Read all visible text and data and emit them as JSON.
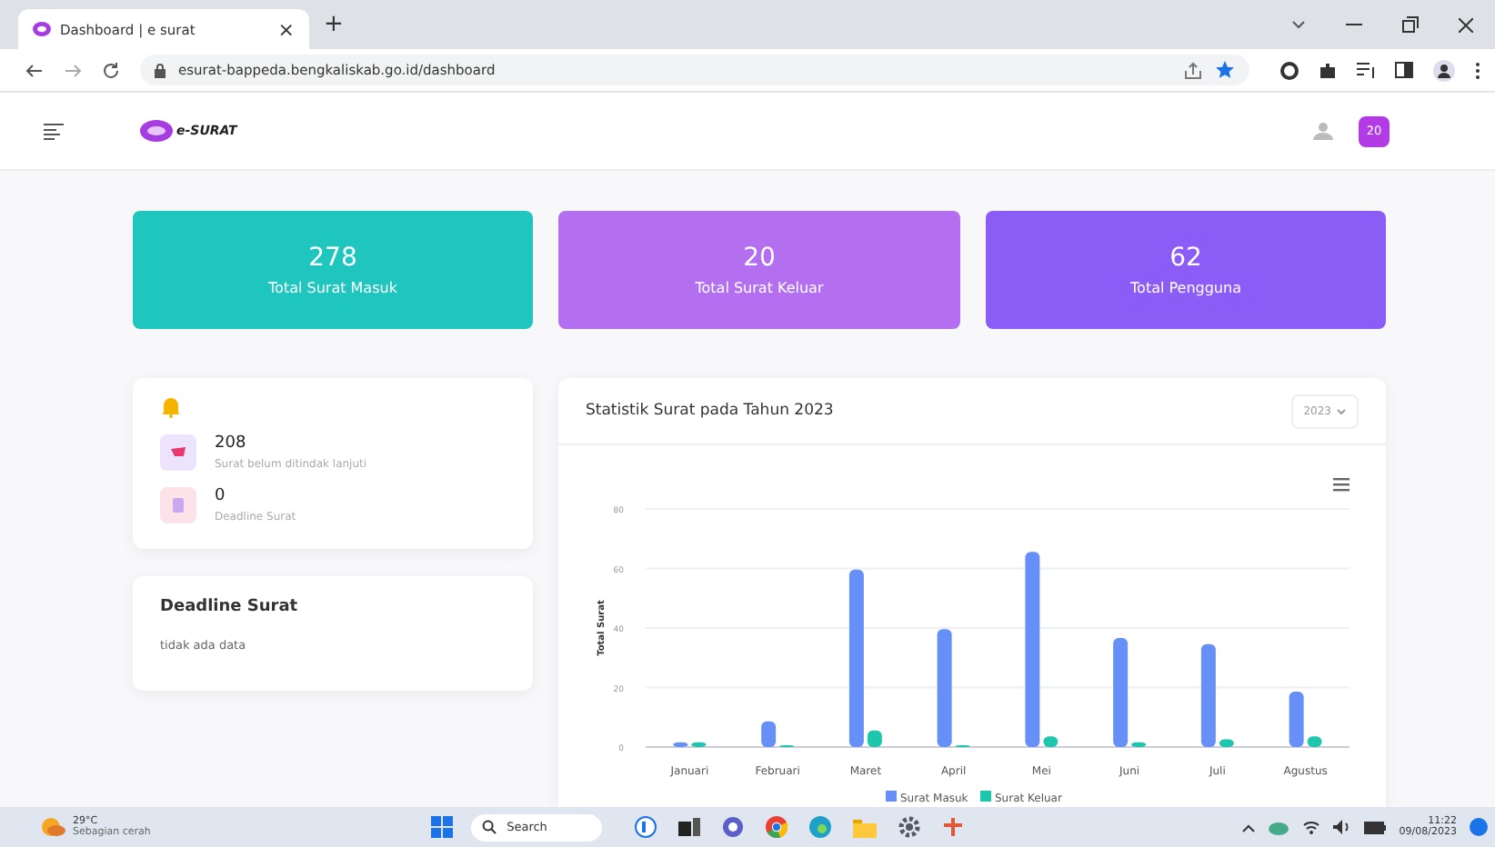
{
  "browser": {
    "tab_title": "Dashboard | e surat",
    "tab_close": "×",
    "new_tab": "+",
    "url": "esurat-bappeda.bengkaliskab.go.id/dashboard"
  },
  "header": {
    "logo": "e-SURAT",
    "badge": "20"
  },
  "stats": [
    {
      "value": "278",
      "label": "Total Surat Masuk",
      "color": "#1ec6be"
    },
    {
      "value": "20",
      "label": "Total Surat Keluar",
      "color": "#b46ff0"
    },
    {
      "value": "62",
      "label": "Total Pengguna",
      "color": "#8c5cf6"
    }
  ],
  "notifications": [
    {
      "kind": "letter",
      "value": "208",
      "label": "Surat belum ditindak lanjuti"
    },
    {
      "kind": "deadline",
      "value": "0",
      "label": "Deadline Surat"
    }
  ],
  "deadline_card": {
    "title": "Deadline Surat",
    "empty": "tidak ada data"
  },
  "chart_card": {
    "title": "Statistik Surat pada Tahun 2023",
    "year_select": "2023",
    "chart_data": {
      "type": "bar",
      "ylabel": "Total Surat",
      "categories": [
        "Januari",
        "Februari",
        "Maret",
        "April",
        "Mei",
        "Juni",
        "Juli",
        "Agustus"
      ],
      "ylim": [
        0,
        80
      ],
      "grid": true,
      "legend": "bottom",
      "yticks": [
        0,
        20,
        40,
        60,
        80
      ],
      "series": [
        {
          "name": "Surat Masuk",
          "color": "#6690f8",
          "values": [
            1,
            8,
            59,
            39,
            65,
            36,
            34,
            18
          ]
        },
        {
          "name": "Surat Keluar",
          "color": "#1ec6ad",
          "values": [
            1,
            0,
            5,
            0,
            3,
            1,
            2,
            3
          ]
        }
      ]
    }
  },
  "taskbar": {
    "temperature": "29°C",
    "weather": "Sebagian cerah",
    "search": "Search",
    "time": "11:22",
    "date": "09/08/2023"
  }
}
